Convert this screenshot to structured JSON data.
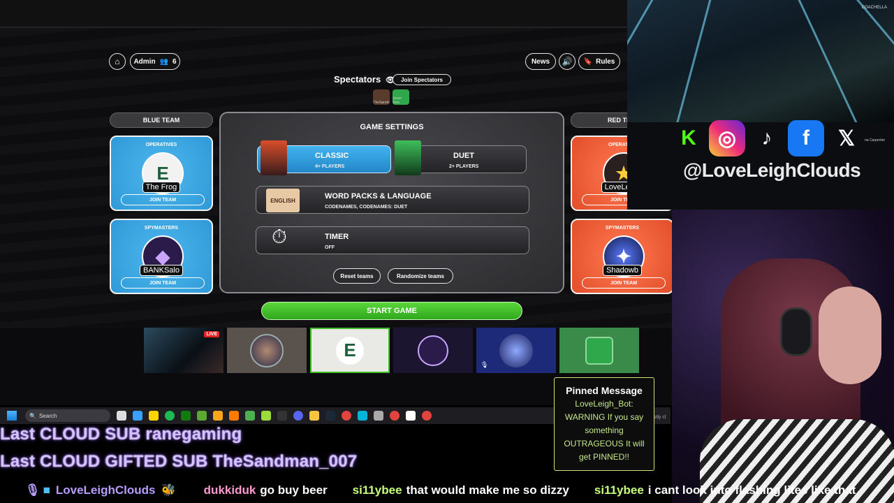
{
  "header": {
    "admin_label": "Admin",
    "player_count": "6",
    "news_label": "News",
    "rules_label": "Rules"
  },
  "spectators": {
    "title": "Spectators",
    "join_label": "Join Spectators",
    "avatars": [
      "TheSandn",
      "Jesse Sine"
    ]
  },
  "blue_team": {
    "title": "BLUE TEAM",
    "operatives_label": "OPERATIVES",
    "operative_name": "The Frog",
    "spymasters_label": "SPYMASTERS",
    "spymaster_name": "BANKSalo",
    "join_label": "JOIN TEAM"
  },
  "red_team": {
    "title": "RED TE",
    "operatives_label": "OPERAT",
    "operative_name": "LoveLeigh",
    "spymasters_label": "SPYMASTERS",
    "spymaster_name": "Shadowb",
    "join_label": "JOIN TEAM"
  },
  "settings": {
    "title": "GAME SETTINGS",
    "classic_title": "CLASSIC",
    "classic_sub": "4+ PLAYERS",
    "duet_title": "DUET",
    "duet_sub": "2+ PLAYERS",
    "wordpacks_title": "WORD PACKS & LANGUAGE",
    "wordpacks_sub": "CODENAMES, CODENAMES: DUET",
    "english_badge": "ENGLISH",
    "timer_title": "TIMER",
    "timer_sub": "OFF",
    "reset_label": "Reset teams",
    "randomize_label": "Randomize teams",
    "start_label": "START GAME"
  },
  "tiles": {
    "live_label": "LIVE"
  },
  "taskbar": {
    "search_placeholder": "Search"
  },
  "stream": {
    "handle": "@LoveLeighClouds",
    "coachella": "COACHELLA",
    "caption": "na Carpenter",
    "pinned_title": "Pinned Message",
    "pinned_body": "LoveLeigh_Bot: WARNING If you say something OUTRAGEOUS It will get PINNED!!",
    "last_sub": "Last CLOUD SUB ranegaming",
    "last_gifted": "Last CLOUD GIFTED SUB TheSandman_007",
    "mostly": "ostly cl"
  },
  "chat": [
    {
      "user": "LoveLeighClouds",
      "msg": "",
      "color": "#b89cff"
    },
    {
      "user": "dukkiduk",
      "msg": "go buy beer",
      "color": "#ff9ad0"
    },
    {
      "user": "si11ybee",
      "msg": "that would make me so dizzy",
      "color": "#c7ff7a"
    },
    {
      "user": "si11ybee",
      "msg": "i cant look into flashing lites like that",
      "color": "#c7ff7a"
    }
  ],
  "colors": {
    "blue_team": "#3aa6e6",
    "red_team": "#ef5f37",
    "start_green": "#3cbf24",
    "pinned_border": "#d6e07a"
  }
}
